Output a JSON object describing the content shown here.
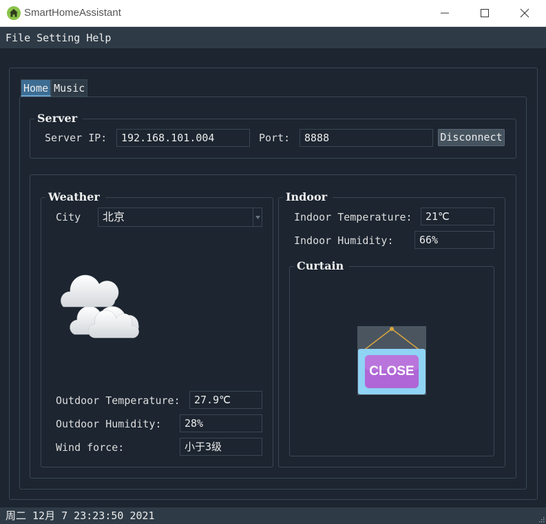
{
  "window": {
    "title": "SmartHomeAssistant"
  },
  "menu": {
    "items": [
      "File",
      "Setting",
      "Help"
    ]
  },
  "tabs": [
    "Home",
    "Music"
  ],
  "server": {
    "title": "Server",
    "ip_label": "Server IP:",
    "ip_value": "192.168.101.004",
    "port_label": "Port:",
    "port_value": "8888",
    "disconnect_label": "Disconnect"
  },
  "weather": {
    "title": "Weather",
    "city_label": "City",
    "city_value": "北京",
    "icon": "cloudy-icon",
    "outdoor_temp_label": "Outdoor Temperature:",
    "outdoor_temp_value": "27.9℃",
    "outdoor_humidity_label": "Outdoor Humidity:",
    "outdoor_humidity_value": "28%",
    "wind_label": "Wind force:",
    "wind_value": "小于3级"
  },
  "indoor": {
    "title": "Indoor",
    "temp_label": "Indoor Temperature:",
    "temp_value": "21℃",
    "humidity_label": "Indoor Humidity:",
    "humidity_value": "66%"
  },
  "curtain": {
    "title": "Curtain",
    "state_label": "CLOSE"
  },
  "status": {
    "datetime": "周二 12月 7 23:23:50 2021"
  },
  "colors": {
    "background": "#1c2530",
    "bar": "#2e3b47",
    "border": "#3a4754",
    "tab_active": "#3d6d93",
    "button": "#45535f",
    "sign_blue": "#8fd3f5",
    "sign_purple": "#b066d6"
  }
}
